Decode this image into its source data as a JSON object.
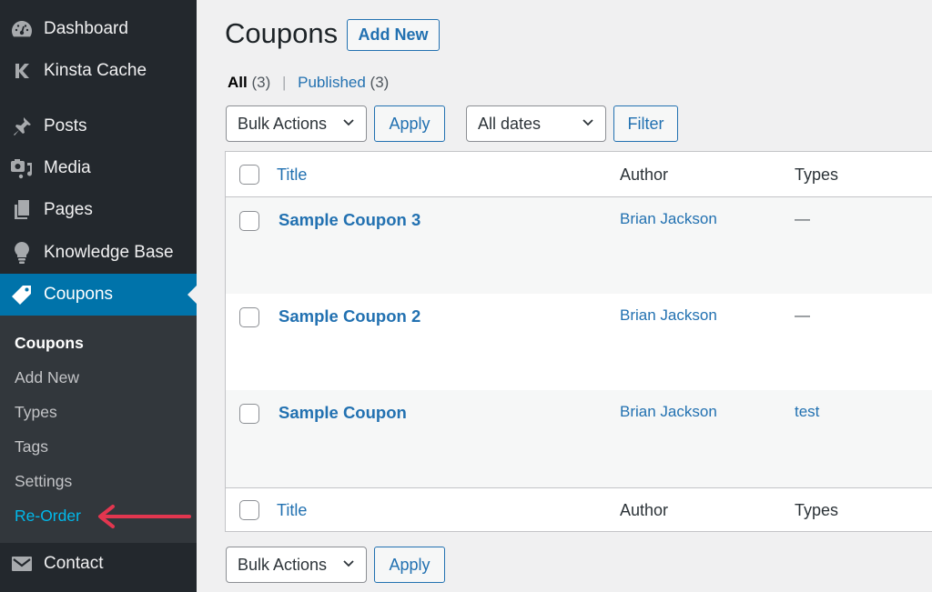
{
  "sidebar": {
    "items": [
      {
        "label": "Dashboard",
        "icon": "dashboard-icon"
      },
      {
        "label": "Kinsta Cache",
        "icon": "kinsta-k-icon"
      },
      {
        "label": "Posts",
        "icon": "pushpin-icon"
      },
      {
        "label": "Media",
        "icon": "media-icon"
      },
      {
        "label": "Pages",
        "icon": "pages-icon"
      },
      {
        "label": "Knowledge Base",
        "icon": "lightbulb-icon"
      },
      {
        "label": "Coupons",
        "icon": "tag-icon",
        "active": true
      },
      {
        "label": "Contact",
        "icon": "envelope-icon"
      }
    ],
    "submenu": [
      {
        "label": "Coupons",
        "current": true
      },
      {
        "label": "Add New"
      },
      {
        "label": "Types"
      },
      {
        "label": "Tags"
      },
      {
        "label": "Settings"
      },
      {
        "label": "Re-Order",
        "highlighted": true
      }
    ]
  },
  "main": {
    "title": "Coupons",
    "add_new_label": "Add New",
    "views": {
      "all_label": "All",
      "all_count": "(3)",
      "separator": "|",
      "published_label": "Published",
      "published_count": "(3)"
    },
    "top_bulk_actions": {
      "selected": "Bulk Actions",
      "apply_label": "Apply"
    },
    "date_filter": {
      "selected": "All dates",
      "filter_label": "Filter"
    },
    "bottom_bulk_actions": {
      "selected": "Bulk Actions",
      "apply_label": "Apply"
    },
    "table": {
      "columns": [
        "Title",
        "Author",
        "Types"
      ],
      "rows": [
        {
          "title": "Sample Coupon 3",
          "author": "Brian Jackson",
          "types": "—"
        },
        {
          "title": "Sample Coupon 2",
          "author": "Brian Jackson",
          "types": "—"
        },
        {
          "title": "Sample Coupon",
          "author": "Brian Jackson",
          "types": "test"
        }
      ]
    }
  },
  "colors": {
    "sidebar_bg": "#23282d",
    "submenu_bg": "#32373c",
    "active_bg": "#0073aa",
    "link": "#2271b1",
    "annotation_arrow": "#e2364f"
  }
}
